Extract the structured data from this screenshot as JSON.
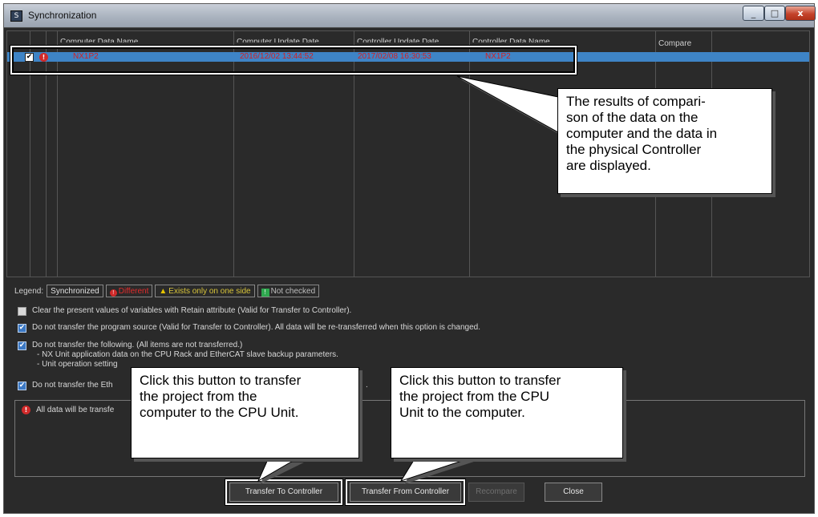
{
  "window": {
    "title": "Synchronization",
    "min_label": "_",
    "max_label": "□",
    "close_label": "x"
  },
  "table": {
    "columns": [
      "Computer Data Name",
      "Computer Update Date",
      "Controller Update Date",
      "Controller Data Name",
      "Compare"
    ],
    "row": {
      "checked": true,
      "status": "different",
      "computer_data_name": "NX1P2",
      "computer_update_date": "2016/12/02 13:44:52",
      "controller_update_date": "2017/02/08 16:30:53",
      "controller_data_name": "NX1P2",
      "compare": ""
    }
  },
  "legend": {
    "label": "Legend:",
    "synchronized": "Synchronized",
    "different": "Different",
    "one_side": "Exists only on one side",
    "not_checked": "Not checked"
  },
  "options": {
    "clear_values": {
      "checked": false,
      "label": "Clear the present values of variables with Retain attribute (Valid for Transfer to Controller)."
    },
    "no_program_source": {
      "checked": true,
      "label": "Do not transfer the program source (Valid for Transfer to Controller). All data will be re-transferred when this option is changed."
    },
    "no_following": {
      "checked": true,
      "label": "Do not transfer the following. (All items are not transferred.)",
      "line1": "- NX Unit application data on the CPU Rack and EtherCAT slave backup parameters.",
      "line2": "- Unit operation setting"
    },
    "no_ethernet": {
      "checked": true,
      "label": "Do not transfer the Eth",
      "suffix": "."
    }
  },
  "message": {
    "text": "All data will be transfe"
  },
  "buttons": {
    "transfer_to": "Transfer To Controller",
    "transfer_from": "Transfer From Controller",
    "recompare": "Recompare",
    "close": "Close"
  },
  "callouts": {
    "results": "The results of compari-\nson of the data on the\ncomputer and the data in\nthe physical Controller\nare displayed.",
    "to_cpu": "Click this button to transfer\nthe project from the\ncomputer to the CPU Unit.",
    "from_cpu": "Click this button to transfer\nthe project from the CPU\nUnit to the computer."
  },
  "colors": {
    "selected_row": "#3e84c6",
    "different": "#e02b2b",
    "background": "#2a2a2a"
  }
}
